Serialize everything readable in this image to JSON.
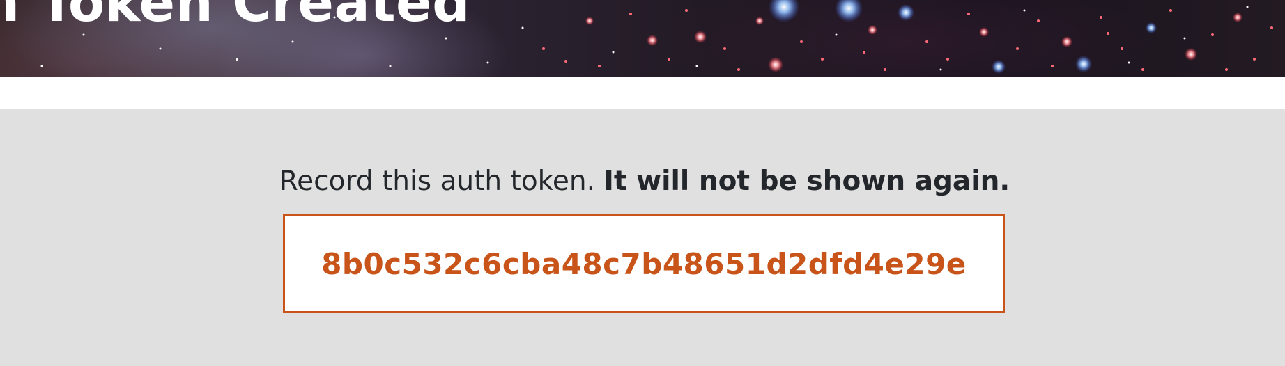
{
  "header": {
    "title": "n Token Created"
  },
  "main": {
    "notice_part1": "Record this auth token. ",
    "notice_part2": "It will not be shown again.",
    "token": "8b0c532c6cba48c7b48651d2dfd4e29e"
  },
  "colors": {
    "accent": "#c8541a",
    "page_background": "#e0e0e0",
    "text": "#23272b"
  }
}
